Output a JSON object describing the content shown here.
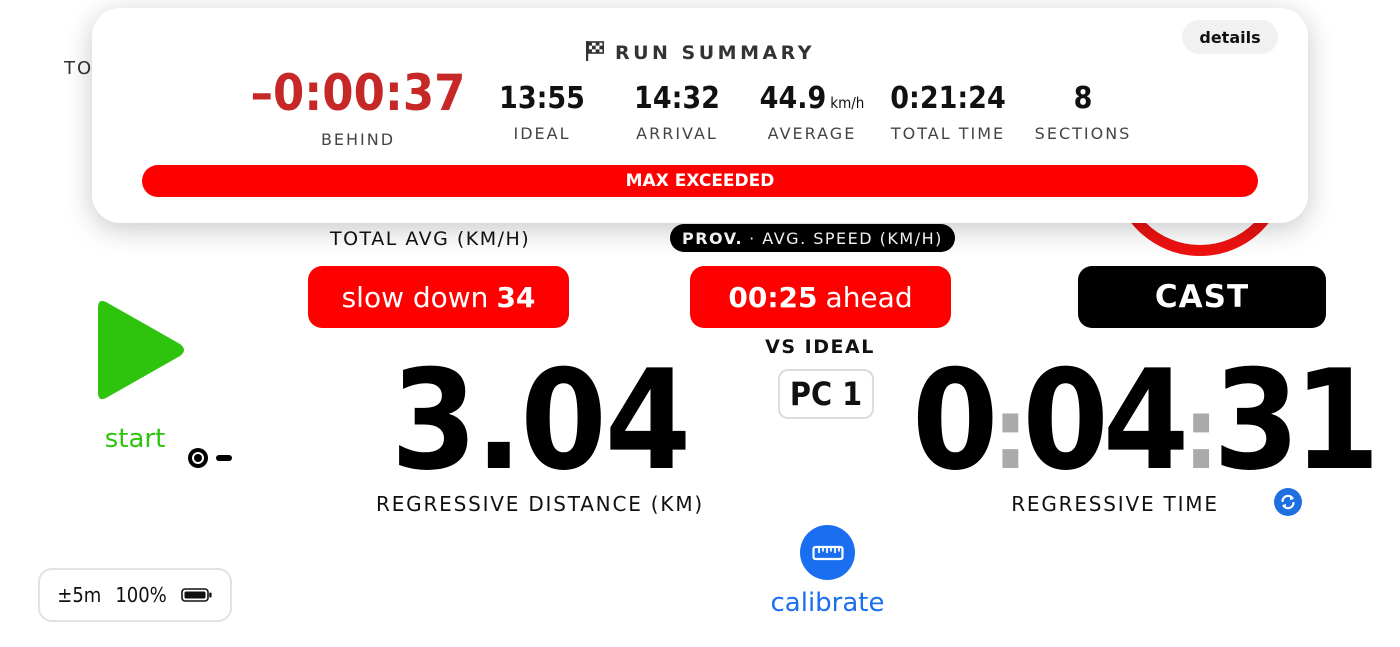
{
  "background": {
    "partial_label": "TO"
  },
  "summary": {
    "title": "RUN SUMMARY",
    "details_label": "details",
    "behind": {
      "value": "–0:00:37",
      "label": "BEHIND"
    },
    "ideal": {
      "value": "13:55",
      "label": "IDEAL"
    },
    "arrival": {
      "value": "14:32",
      "label": "ARRIVAL"
    },
    "average": {
      "value": "44.9",
      "unit": "km/h",
      "label": "AVERAGE"
    },
    "total_time": {
      "value": "0:21:24",
      "label": "TOTAL TIME"
    },
    "sections": {
      "value": "8",
      "label": "SECTIONS"
    },
    "max_exceeded": "MAX EXCEEDED"
  },
  "main": {
    "total_avg_label": "TOTAL AVG (KM/H)",
    "prov_prefix": "PROV.",
    "prov_label": "· AVG. SPEED (KM/H)",
    "slow_down_text": "slow down",
    "slow_down_value": "34",
    "ahead_time": "00:25",
    "ahead_text": "ahead",
    "vs_ideal_label": "VS IDEAL",
    "cast_label": "CAST",
    "pc_badge": "PC 1",
    "start_label": "start",
    "distance": {
      "value": "3.04",
      "label": "REGRESSIVE DISTANCE (KM)"
    },
    "time": {
      "hours": "0",
      "minutes": "04",
      "seconds": "31",
      "label": "REGRESSIVE TIME"
    },
    "calibrate_label": "calibrate"
  },
  "status": {
    "accuracy": "±5m",
    "battery": "100%"
  },
  "colors": {
    "accent_red": "#ff0000",
    "behind_red": "#c62828",
    "start_green": "#2ec40e",
    "calibrate_blue": "#1a6ff0"
  }
}
